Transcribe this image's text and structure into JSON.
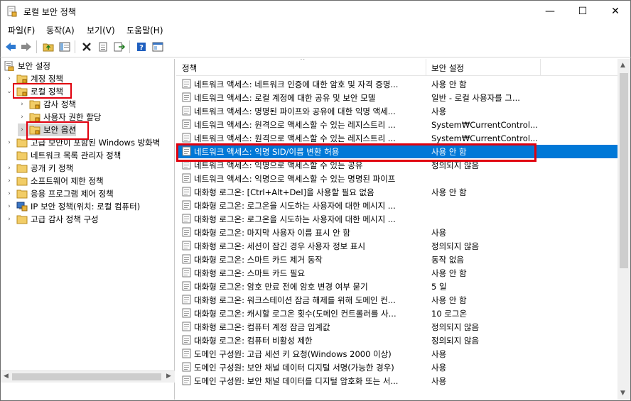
{
  "window": {
    "title": "로컬 보안 정책",
    "minimize": "—",
    "maximize": "☐",
    "close": "✕"
  },
  "menu": [
    "파일(F)",
    "동작(A)",
    "보기(V)",
    "도움말(H)"
  ],
  "tree": {
    "root": "보안 설정",
    "items": [
      {
        "label": "계정 정책",
        "expander": "›"
      },
      {
        "label": "로컬 정책",
        "expander": "⌄"
      },
      {
        "label": "감사 정책",
        "expander": "›"
      },
      {
        "label": "사용자 권한 할당",
        "expander": "›"
      },
      {
        "label": "보안 옵션",
        "expander": "›"
      },
      {
        "label": "고급 보안이 포함된 Windows 방화벽",
        "expander": "›"
      },
      {
        "label": "네트워크 목록 관리자 정책",
        "expander": ""
      },
      {
        "label": "공개 키 정책",
        "expander": "›"
      },
      {
        "label": "소프트웨어 제한 정책",
        "expander": "›"
      },
      {
        "label": "응용 프로그램 제어 정책",
        "expander": "›"
      },
      {
        "label": "IP 보안 정책(위치: 로컬 컴퓨터)",
        "expander": "›"
      },
      {
        "label": "고급 감사 정책 구성",
        "expander": "›"
      }
    ]
  },
  "list": {
    "col_policy": "정책",
    "col_setting": "보안 설정",
    "rows": [
      {
        "policy": "네트워크 액세스: 네트워크 인증에 대한 암호 및 자격 증명...",
        "setting": "사용 안 함"
      },
      {
        "policy": "네트워크 액세스: 로컬 계정에 대한 공유 및 보안 모델",
        "setting": "일반 - 로컬 사용자를 그..."
      },
      {
        "policy": "네트워크 액세스: 명명된 파이프와 공유에 대한 익명 액세...",
        "setting": "사용"
      },
      {
        "policy": "네트워크 액세스: 원격으로 액세스할 수 있는 레지스트리 ...",
        "setting": "System₩CurrentControl..."
      },
      {
        "policy": "네트워크 액세스: 원격으로 액세스할 수 있는 레지스트리 ...",
        "setting": "System₩CurrentControl..."
      },
      {
        "policy": "네트워크 액세스: 익명 SID/이름 변환 허용",
        "setting": "사용 안 함"
      },
      {
        "policy": "네트워크 액세스: 익명으로 액세스할 수 있는 공유",
        "setting": "정의되지 않음"
      },
      {
        "policy": "네트워크 액세스: 익명으로 액세스할 수 있는 명명된 파이프",
        "setting": ""
      },
      {
        "policy": "대화형 로그온: [Ctrl+Alt+Del]을 사용할 필요 없음",
        "setting": "사용 안 함"
      },
      {
        "policy": "대화형 로그온: 로그온을 시도하는 사용자에 대한 메시지 ...",
        "setting": ""
      },
      {
        "policy": "대화형 로그온: 로그온을 시도하는 사용자에 대한 메시지 ...",
        "setting": ""
      },
      {
        "policy": "대화형 로그온: 마지막 사용자 이름 표시 안 함",
        "setting": "사용"
      },
      {
        "policy": "대화형 로그온: 세션이 잠긴 경우 사용자 정보 표시",
        "setting": "정의되지 않음"
      },
      {
        "policy": "대화형 로그온: 스마트 카드 제거 동작",
        "setting": "동작 없음"
      },
      {
        "policy": "대화형 로그온: 스마트 카드 필요",
        "setting": "사용 안 함"
      },
      {
        "policy": "대화형 로그온: 암호 만료 전에 암호 변경 여부 묻기",
        "setting": "5 일"
      },
      {
        "policy": "대화형 로그온: 워크스테이션 잠금 해제를 위해 도메인 컨...",
        "setting": "사용 안 함"
      },
      {
        "policy": "대화형 로그온: 캐시할 로그온 횟수(도메인 컨트롤러를 사...",
        "setting": "10 로그온"
      },
      {
        "policy": "대화형 로그온: 컴퓨터 계정 잠금 임계값",
        "setting": "정의되지 않음"
      },
      {
        "policy": "대화형 로그온: 컴퓨터 비활성 제한",
        "setting": "정의되지 않음"
      },
      {
        "policy": "도메인 구성원: 고급 세션 키 요청(Windows 2000 이상)",
        "setting": "사용"
      },
      {
        "policy": "도메인 구성원: 보안 채널 데이터 디지털 서명(가능한 경우)",
        "setting": "사용"
      },
      {
        "policy": "도메인 구성원: 보안 채널 데이터를 디지털 암호화 또는 서...",
        "setting": "사용"
      }
    ]
  }
}
